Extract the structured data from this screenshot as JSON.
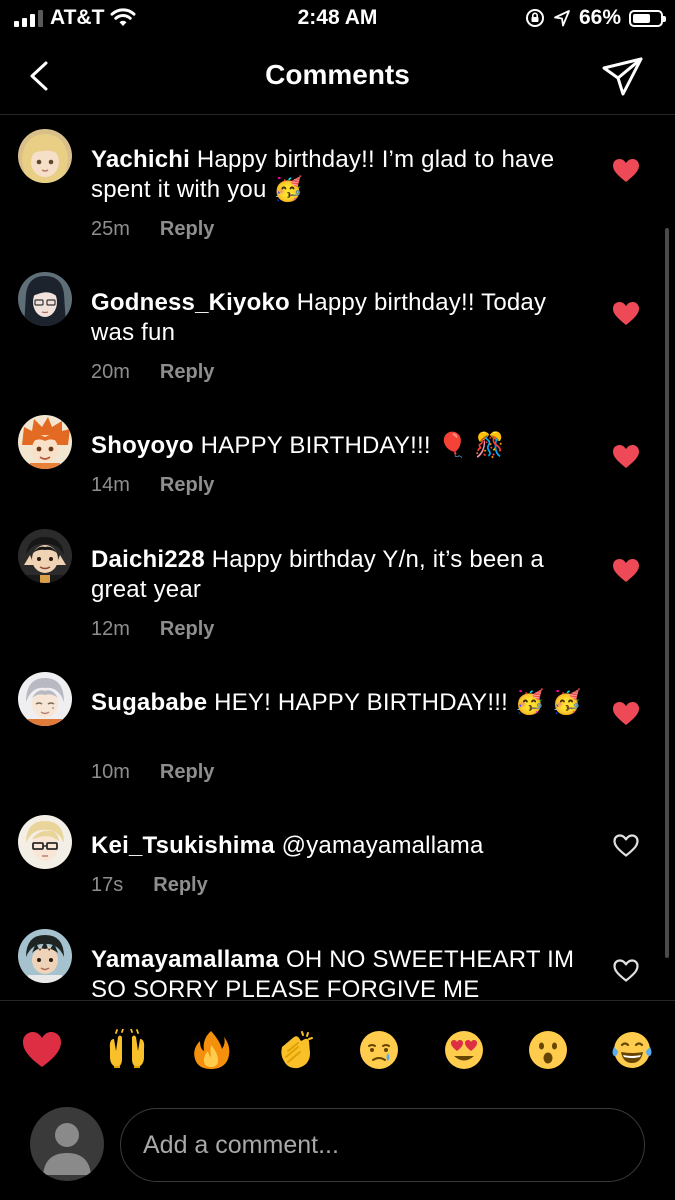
{
  "status_bar": {
    "carrier": "AT&T",
    "time": "2:48 AM",
    "battery": "66%",
    "battery_level": 0.66
  },
  "header": {
    "title": "Comments"
  },
  "comments": [
    {
      "user": "Yachichi",
      "text": "Happy birthday!! I’m glad to have spent it with you 🥳",
      "time": "25m",
      "reply": "Reply",
      "liked": true
    },
    {
      "user": "Godness_Kiyoko",
      "text": "Happy birthday!! Today was fun",
      "time": "20m",
      "reply": "Reply",
      "liked": true
    },
    {
      "user": "Shoyoyo",
      "text": "HAPPY BIRTHDAY!!! 🎈 🎊",
      "time": "14m",
      "reply": "Reply",
      "liked": true
    },
    {
      "user": "Daichi228",
      "text": "Happy birthday Y/n, it’s been a great year",
      "time": "12m",
      "reply": "Reply",
      "liked": true
    },
    {
      "user": "Sugababe",
      "text": "HEY! HAPPY BIRTHDAY!!! 🥳 🥳",
      "time": "10m",
      "reply": "Reply",
      "liked": true
    },
    {
      "user": "Kei_Tsukishima",
      "text": "@yamayamallama",
      "time": "17s",
      "reply": "Reply",
      "liked": false
    },
    {
      "user": "Yamayamallama",
      "text": "OH NO SWEETHEART IM SO SORRY PLEASE FORGIVE ME",
      "time": "",
      "reply": "",
      "liked": false
    }
  ],
  "emoji_bar": [
    "❤️",
    "🙌",
    "🔥",
    "👏",
    "😢",
    "😍",
    "😮",
    "😂"
  ],
  "composer": {
    "placeholder": "Add a comment..."
  },
  "colors": {
    "background": "#000000",
    "liked_heart": "#ed4956",
    "meta_text": "#8e8e8e"
  }
}
